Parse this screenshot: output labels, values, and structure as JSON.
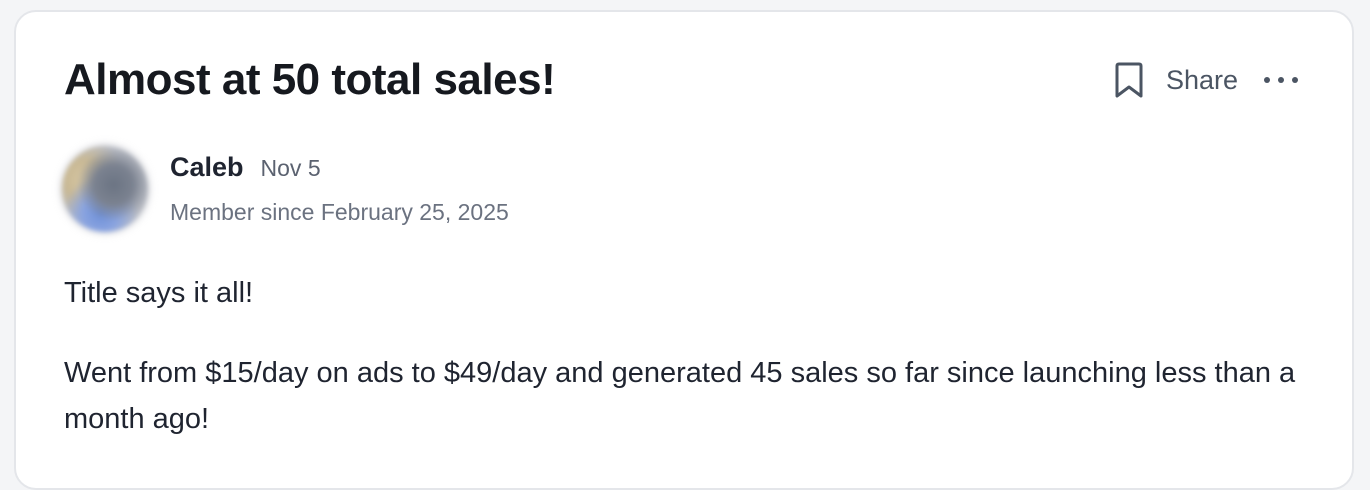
{
  "post": {
    "title": "Almost at 50 total sales!",
    "actions": {
      "bookmark_icon": "bookmark-icon",
      "share_label": "Share",
      "more_icon": "more-horizontal-icon"
    },
    "author": {
      "name": "Caleb",
      "date": "Nov 5",
      "member_since": "Member since February 25, 2025"
    },
    "paragraphs": [
      "Title says it all!",
      "Went from $15/day on ads to $49/day and generated 45 sales so far since launching less than a month ago!"
    ]
  },
  "colors": {
    "title": "#16191f",
    "text": "#1f2430",
    "muted": "#6b7280",
    "card_border": "#e4e6ea"
  }
}
